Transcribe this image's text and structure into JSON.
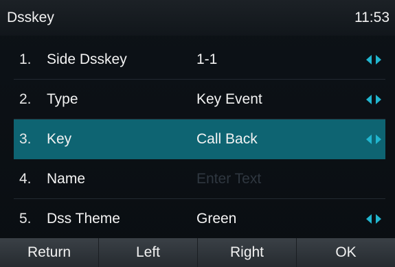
{
  "titlebar": {
    "title": "Dsskey",
    "time": "11:53"
  },
  "rows": [
    {
      "num": "1.",
      "label": "Side Dsskey",
      "value": "1-1",
      "arrows": true
    },
    {
      "num": "2.",
      "label": "Type",
      "value": "Key Event",
      "arrows": true
    },
    {
      "num": "3.",
      "label": "Key",
      "value": "Call Back",
      "arrows": true,
      "selected": true
    },
    {
      "num": "4.",
      "label": "Name",
      "value": "",
      "placeholder": "Enter Text",
      "arrows": false
    },
    {
      "num": "5.",
      "label": "Dss Theme",
      "value": "Green",
      "arrows": true
    }
  ],
  "softkeys": [
    "Return",
    "Left",
    "Right",
    "OK"
  ],
  "colors": {
    "accent": "#21b6cf",
    "selected_row": "#0e6472"
  }
}
